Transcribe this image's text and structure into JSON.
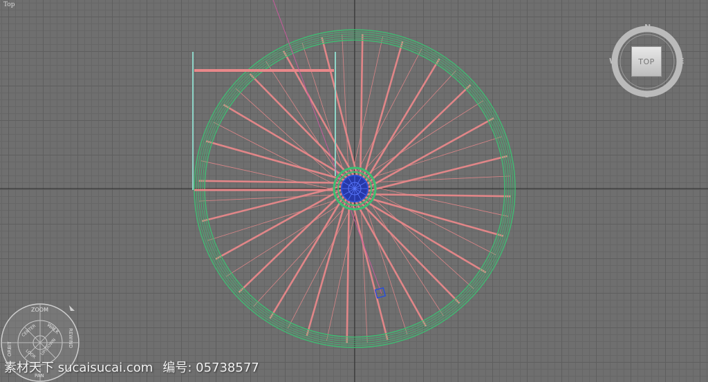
{
  "viewport": {
    "label": "Top",
    "colors": {
      "grid_bg": "#6f6f6f",
      "rim": "#3dbf72",
      "spoke": "#e8888a",
      "hub": "#2a4fd6",
      "axis": "#2b2b2b"
    }
  },
  "viewcube": {
    "face_label": "TOP",
    "compass": {
      "north": "N",
      "south": "S",
      "east": "E",
      "west": "W"
    }
  },
  "steering_wheel": {
    "wedges": [
      "ZOOM",
      "WALK",
      "REWIND",
      "ORBIT",
      "CENTER",
      "LOOK",
      "UP/DOWN",
      "PAN"
    ]
  },
  "watermark": {
    "site": "素材天下 sucaisucai.com",
    "id": "编号: 05738577"
  }
}
